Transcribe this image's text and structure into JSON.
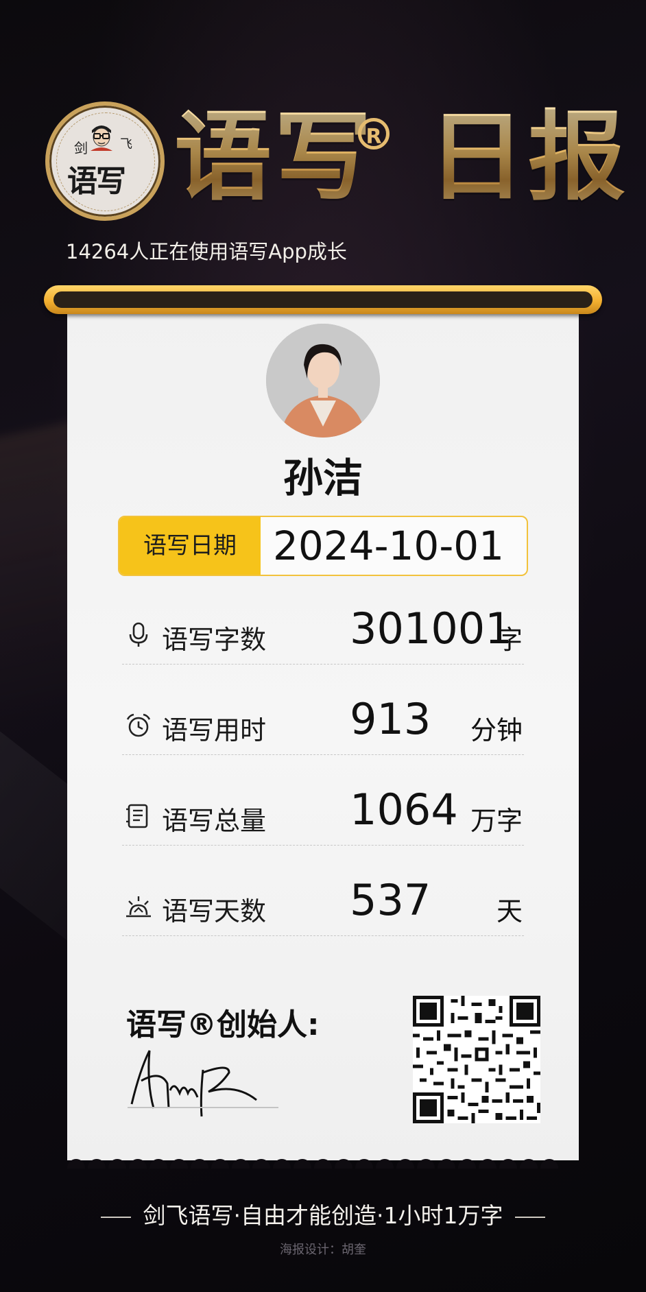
{
  "header": {
    "logo": {
      "top_text_left": "剑",
      "top_text_right": "飞",
      "bottom_text": "语写"
    },
    "title": "语写®日报",
    "title_main": "语写",
    "title_reg": "R",
    "title_suffix": "日报",
    "users_line": "14264人正在使用语写App成长"
  },
  "user": {
    "name": "孙洁"
  },
  "date": {
    "label": "语写日期",
    "value": "2024-10-01"
  },
  "stats": [
    {
      "icon": "microphone-icon",
      "label": "语写字数",
      "value": "301001",
      "unit": "字"
    },
    {
      "icon": "alarm-clock-icon",
      "label": "语写用时",
      "value": "913",
      "unit": "分钟"
    },
    {
      "icon": "document-icon",
      "label": "语写总量",
      "value": "1064",
      "unit": "万字"
    },
    {
      "icon": "sunrise-icon",
      "label": "语写天数",
      "value": "537",
      "unit": "天"
    }
  ],
  "founder": {
    "label": "语写®创始人:"
  },
  "footer": {
    "tagline": "剑飞语写·自由才能创造·1小时1万字",
    "design_credit": "海报设计：胡奎"
  },
  "colors": {
    "gold_title": "#e2b868",
    "yellow_accent": "#f6c31a",
    "background": "#0f0c11",
    "card": "#f3f3f3"
  }
}
